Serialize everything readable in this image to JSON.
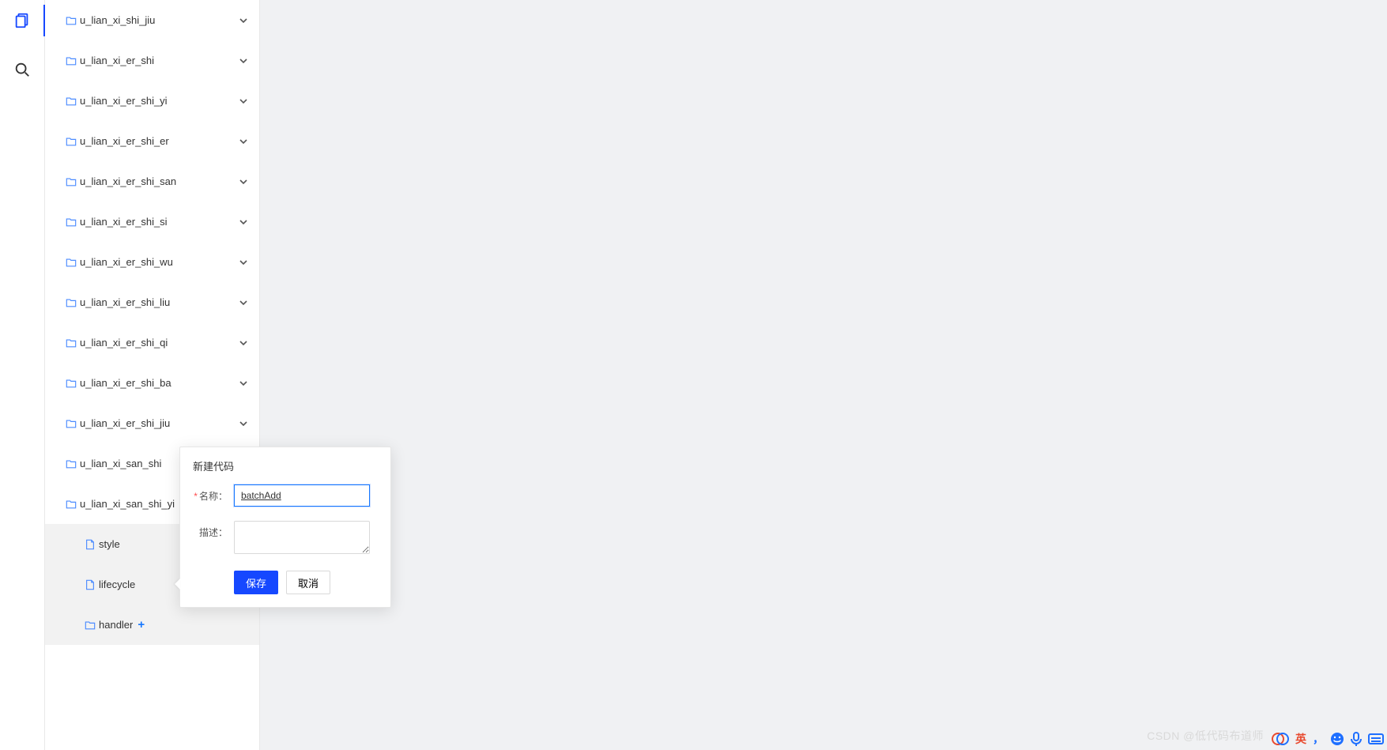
{
  "tree": {
    "folders": [
      "u_lian_xi_shi_jiu",
      "u_lian_xi_er_shi",
      "u_lian_xi_er_shi_yi",
      "u_lian_xi_er_shi_er",
      "u_lian_xi_er_shi_san",
      "u_lian_xi_er_shi_si",
      "u_lian_xi_er_shi_wu",
      "u_lian_xi_er_shi_liu",
      "u_lian_xi_er_shi_qi",
      "u_lian_xi_er_shi_ba",
      "u_lian_xi_er_shi_jiu",
      "u_lian_xi_san_shi",
      "u_lian_xi_san_shi_yi"
    ],
    "nested_files": [
      "style",
      "lifecycle"
    ],
    "nested_folder": "handler"
  },
  "popover": {
    "title": "新建代码",
    "name_label": "名称",
    "desc_label": "描述",
    "colon": "：",
    "name_value": "batchAdd",
    "desc_value": "",
    "save": "保存",
    "cancel": "取消"
  },
  "watermark": "CSDN @低代码布道师",
  "ime": {
    "lang": "英",
    "comma": "，"
  }
}
